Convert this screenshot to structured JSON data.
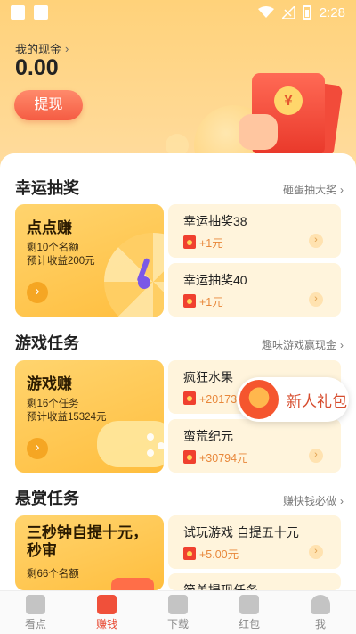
{
  "status_bar": {
    "time": "2:28"
  },
  "header": {
    "cash_label": "我的现金",
    "cash_value": "0.00",
    "withdraw_label": "提现",
    "envelope_symbol": "¥"
  },
  "sections": [
    {
      "title": "幸运抽奖",
      "link": "砸蛋抽大奖",
      "big_card": {
        "title": "点点赚",
        "line1": "剩10个名额",
        "line2": "预计收益200元"
      },
      "items": [
        {
          "title": "幸运抽奖38",
          "reward": "+1元"
        },
        {
          "title": "幸运抽奖40",
          "reward": "+1元"
        }
      ]
    },
    {
      "title": "游戏任务",
      "link": "趣味游戏赢现金",
      "big_card": {
        "title": "游戏赚",
        "line1": "剩16个任务",
        "line2": "预计收益15324元"
      },
      "items": [
        {
          "title": "疯狂水果",
          "reward": "+20173元"
        },
        {
          "title": "蛮荒纪元",
          "reward": "+30794元"
        }
      ]
    },
    {
      "title": "悬赏任务",
      "link": "赚快钱必做",
      "big_card": {
        "title": "三秒钟自提十元，秒审",
        "line1": "剩66个名额",
        "line2": ""
      },
      "items": [
        {
          "title": "试玩游戏 自提五十元",
          "reward": "+5.00元"
        },
        {
          "title": "简单提现任务",
          "reward": ""
        }
      ]
    }
  ],
  "gift": {
    "label": "新人礼包"
  },
  "bottom_nav": [
    {
      "label": "看点",
      "icon": "news-icon",
      "active": false
    },
    {
      "label": "赚钱",
      "icon": "gamepad-icon",
      "active": true
    },
    {
      "label": "下载",
      "icon": "download-icon",
      "active": false
    },
    {
      "label": "红包",
      "icon": "red-envelope-icon",
      "active": false
    },
    {
      "label": "我",
      "icon": "person-icon",
      "active": false
    }
  ],
  "colors": {
    "accent": "#f0503a",
    "header_bg": "#ffd27a",
    "reward": "#e8873a"
  }
}
